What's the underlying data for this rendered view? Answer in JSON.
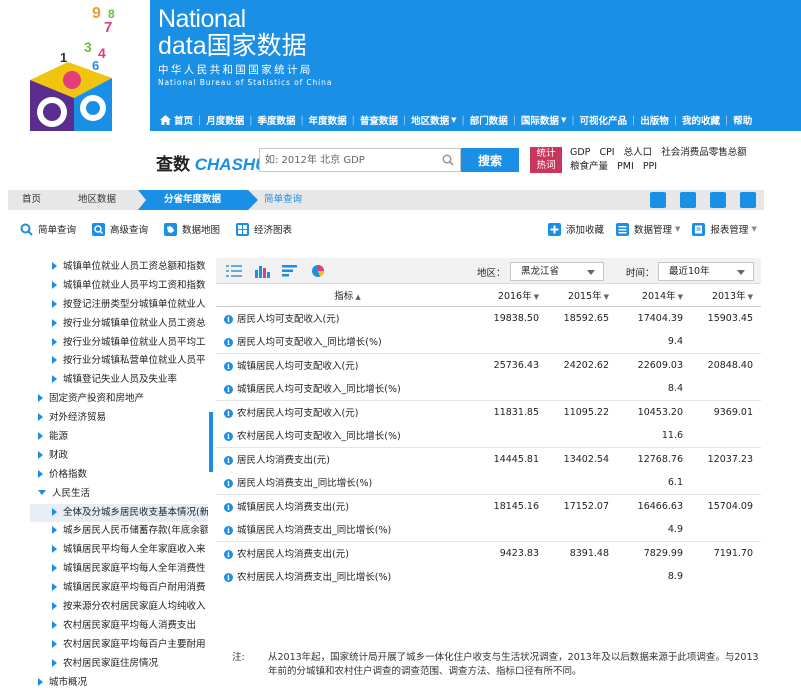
{
  "brand": {
    "line1": "National",
    "line2": "data国家数据",
    "line3": "中华人民共和国国家统计局",
    "line4": "National Bureau of Statistics of China"
  },
  "nav": [
    {
      "label": "首页",
      "caret": false
    },
    {
      "label": "月度数据",
      "caret": false
    },
    {
      "label": "季度数据",
      "caret": false
    },
    {
      "label": "年度数据",
      "caret": false
    },
    {
      "label": "普查数据",
      "caret": false
    },
    {
      "label": "地区数据",
      "caret": true
    },
    {
      "label": "部门数据",
      "caret": false
    },
    {
      "label": "国际数据",
      "caret": true
    },
    {
      "label": "可视化产品",
      "caret": false
    },
    {
      "label": "出版物",
      "caret": false
    },
    {
      "label": "我的收藏",
      "caret": false
    },
    {
      "label": "帮助",
      "caret": false
    }
  ],
  "search": {
    "logo_a": "查数",
    "logo_b": "CHASHU",
    "placeholder": "如: 2012年 北京 GDP",
    "button": "搜索",
    "hot_label_1": "统计",
    "hot_label_2": "热词",
    "hot_words": [
      "GDP",
      "CPI",
      "总人口",
      "社会消费品零售总额",
      "粮食产量",
      "PMI",
      "PPI"
    ]
  },
  "breadcrumb": {
    "home": "首页",
    "region": "地区数据",
    "active": "分省年度数据",
    "simple": "简单查询"
  },
  "tools": {
    "simple_query": "简单查询",
    "advanced_query": "高级查询",
    "data_map": "数据地图",
    "economy_chart": "经济图表",
    "add_favorite": "添加收藏",
    "data_manage": "数据管理",
    "report_manage": "报表管理"
  },
  "tree": [
    {
      "label": "城镇单位就业人员工资总额和指数",
      "level": 2,
      "expanded": false,
      "selected": false
    },
    {
      "label": "城镇单位就业人员平均工资和指数",
      "level": 2,
      "expanded": false,
      "selected": false
    },
    {
      "label": "按登记注册类型分城镇单位就业人",
      "level": 2,
      "expanded": false,
      "selected": false
    },
    {
      "label": "按行业分城镇单位就业人员工资总",
      "level": 2,
      "expanded": false,
      "selected": false
    },
    {
      "label": "按行业分城镇单位就业人员平均工",
      "level": 2,
      "expanded": false,
      "selected": false
    },
    {
      "label": "按行业分城镇私营单位就业人员平",
      "level": 2,
      "expanded": false,
      "selected": false
    },
    {
      "label": "城镇登记失业人员及失业率",
      "level": 2,
      "expanded": false,
      "selected": false
    },
    {
      "label": "固定资产投资和房地产",
      "level": 1,
      "expanded": false,
      "selected": false
    },
    {
      "label": "对外经济贸易",
      "level": 1,
      "expanded": false,
      "selected": false
    },
    {
      "label": "能源",
      "level": 1,
      "expanded": false,
      "selected": false
    },
    {
      "label": "财政",
      "level": 1,
      "expanded": false,
      "selected": false
    },
    {
      "label": "价格指数",
      "level": 1,
      "expanded": false,
      "selected": false
    },
    {
      "label": "人民生活",
      "level": 1,
      "expanded": true,
      "selected": false
    },
    {
      "label": "全体及分城乡居民收支基本情况(新",
      "level": 2,
      "expanded": false,
      "selected": true
    },
    {
      "label": "城乡居民人民币储蓄存款(年底余额",
      "level": 2,
      "expanded": false,
      "selected": false
    },
    {
      "label": "城镇居民平均每人全年家庭收入来",
      "level": 2,
      "expanded": false,
      "selected": false
    },
    {
      "label": "城镇居民家庭平均每人全年消费性",
      "level": 2,
      "expanded": false,
      "selected": false
    },
    {
      "label": "城镇居民家庭平均每百户耐用消费",
      "level": 2,
      "expanded": false,
      "selected": false
    },
    {
      "label": "按来源分农村居民家庭人均纯收入",
      "level": 2,
      "expanded": false,
      "selected": false
    },
    {
      "label": "农村居民家庭平均每人消费支出",
      "level": 2,
      "expanded": false,
      "selected": false
    },
    {
      "label": "农村居民家庭平均每百户主要耐用",
      "level": 2,
      "expanded": false,
      "selected": false
    },
    {
      "label": "农村居民家庭住房情况",
      "level": 2,
      "expanded": false,
      "selected": false
    },
    {
      "label": "城市概况",
      "level": 1,
      "expanded": false,
      "selected": false
    }
  ],
  "filters": {
    "region_label": "地区：",
    "region_value": "黑龙江省",
    "time_label": "时间：",
    "time_value": "最近10年"
  },
  "table": {
    "headers": [
      "指标",
      "2016年",
      "2015年",
      "2014年",
      "2013年"
    ],
    "rows": [
      {
        "name": "居民人均可支配收入(元)",
        "values": [
          "19838.50",
          "18592.65",
          "17404.39",
          "15903.45"
        ],
        "info": true
      },
      {
        "name": "居民人均可支配收入_同比增长(%)",
        "values": [
          "",
          "",
          "9.4",
          ""
        ],
        "info": true
      },
      {
        "name": "城镇居民人均可支配收入(元)",
        "values": [
          "25736.43",
          "24202.62",
          "22609.03",
          "20848.40"
        ],
        "info": true
      },
      {
        "name": "城镇居民人均可支配收入_同比增长(%)",
        "values": [
          "",
          "",
          "8.4",
          ""
        ],
        "info": true
      },
      {
        "name": "农村居民人均可支配收入(元)",
        "values": [
          "11831.85",
          "11095.22",
          "10453.20",
          "9369.01"
        ],
        "info": true
      },
      {
        "name": "农村居民人均可支配收入_同比增长(%)",
        "values": [
          "",
          "",
          "11.6",
          ""
        ],
        "info": true
      },
      {
        "name": "居民人均消费支出(元)",
        "values": [
          "14445.81",
          "13402.54",
          "12768.76",
          "12037.23"
        ],
        "info": true
      },
      {
        "name": "居民人均消费支出_同比增长(%)",
        "values": [
          "",
          "",
          "6.1",
          ""
        ],
        "info": true
      },
      {
        "name": "城镇居民人均消费支出(元)",
        "values": [
          "18145.16",
          "17152.07",
          "16466.63",
          "15704.09"
        ],
        "info": true
      },
      {
        "name": "城镇居民人均消费支出_同比增长(%)",
        "values": [
          "",
          "",
          "4.9",
          ""
        ],
        "info": true
      },
      {
        "name": "农村居民人均消费支出(元)",
        "values": [
          "9423.83",
          "8391.48",
          "7829.99",
          "7191.70"
        ],
        "info": true
      },
      {
        "name": "农村居民人均消费支出_同比增长(%)",
        "values": [
          "",
          "",
          "8.9",
          ""
        ],
        "info": true
      }
    ]
  },
  "note": {
    "label": "注:",
    "text": "从2013年起，国家统计局开展了城乡一体化住户收支与生活状况调查，2013年及以后数据来源于此项调查。与2013年前的分城镇和农村住户调查的调查范围、调查方法、指标口径有所不同。"
  },
  "colors": {
    "brand_blue": "#1a8fe6",
    "hot_red": "#c8365c"
  }
}
